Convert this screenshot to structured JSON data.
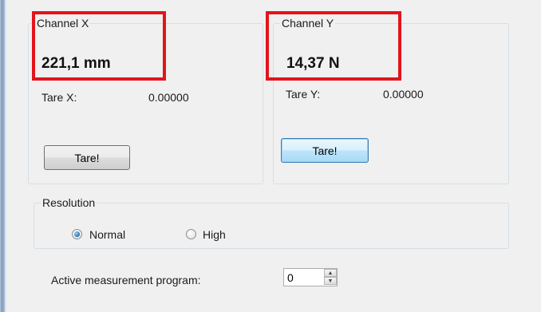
{
  "channel_x": {
    "legend": "Channel X",
    "value": "221,1 mm",
    "tare_label": "Tare X:",
    "tare_value": "0.00000",
    "tare_button": "Tare!"
  },
  "channel_y": {
    "legend": "Channel Y",
    "value": "14,37 N",
    "tare_label": "Tare Y:",
    "tare_value": "0.00000",
    "tare_button": "Tare!"
  },
  "resolution": {
    "legend": "Resolution",
    "options": [
      {
        "label": "Normal",
        "selected": true
      },
      {
        "label": "High",
        "selected": false
      }
    ]
  },
  "program": {
    "label": "Active measurement program:",
    "value": "0"
  },
  "colors": {
    "highlight": "#e3141b",
    "panel_background": "#f0f0f0",
    "group_border": "#d5dfe5"
  }
}
